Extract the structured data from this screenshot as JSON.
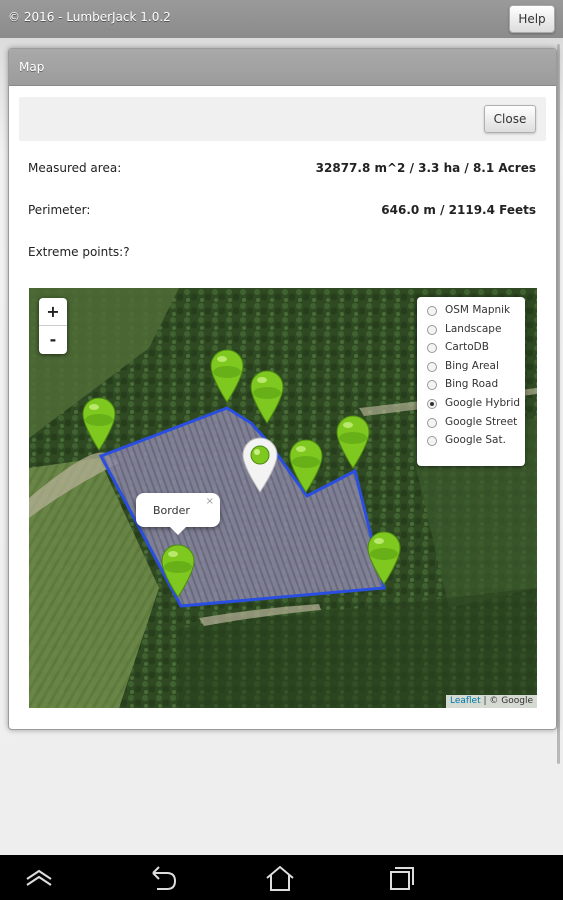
{
  "app": {
    "title": "© 2016 - LumberJack 1.0.2",
    "help_label": "Help"
  },
  "dialog": {
    "title": "Map",
    "close_label": "Close",
    "measured_area_label": "Measured area:",
    "measured_area_value": "32877.8 m^2 / 3.3 ha / 8.1 Acres",
    "perimeter_label": "Perimeter:",
    "perimeter_value": "646.0 m / 2119.4 Feets",
    "extreme_points_label": "Extreme points:?"
  },
  "map": {
    "zoom_in": "+",
    "zoom_out": "-",
    "layers": [
      {
        "label": "OSM Mapnik",
        "selected": false
      },
      {
        "label": "Landscape",
        "selected": false
      },
      {
        "label": "CartoDB",
        "selected": false
      },
      {
        "label": "Bing Areal",
        "selected": false
      },
      {
        "label": "Bing Road",
        "selected": false
      },
      {
        "label": "Google Hybrid",
        "selected": true
      },
      {
        "label": "Google Street",
        "selected": false
      },
      {
        "label": "Google Sat.",
        "selected": false
      }
    ],
    "popup_text": "Border",
    "popup_close": "×",
    "attribution_link": "Leaflet",
    "attribution_rest": " | © Google",
    "polygon_color": "#2a4fe0",
    "marker_color": "#7ec820"
  },
  "nav": {
    "icons": [
      "collapse-icon",
      "back-icon",
      "home-icon",
      "recent-apps-icon"
    ]
  }
}
